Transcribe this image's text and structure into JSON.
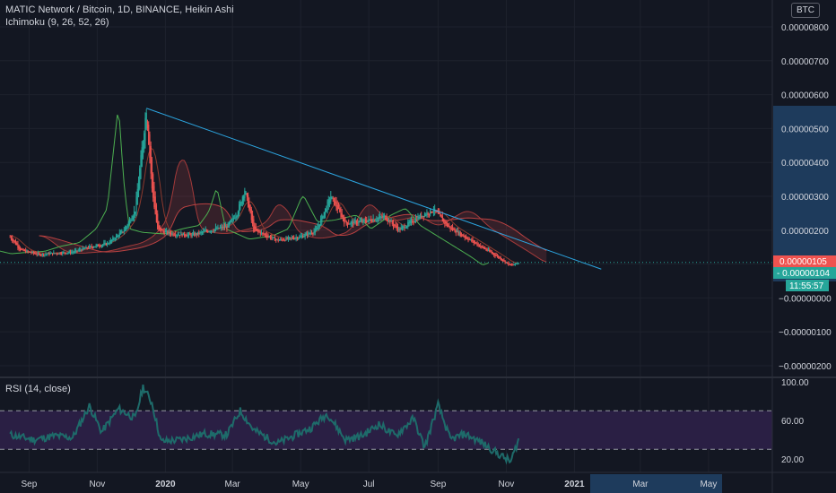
{
  "header": {
    "title": "MATIC Network / Bitcoin, 1D, BINANCE, Heikin Ashi",
    "indicator": "Ichimoku (9, 26, 52, 26)",
    "currency_button": "BTC"
  },
  "price_axis": {
    "ticks": [
      "0.00000800",
      "0.00000700",
      "0.00000600",
      "0.00000500",
      "0.00000400",
      "0.00000300",
      "0.00000200",
      "0.00000105",
      "0.00000104",
      "−0.00000000",
      "−0.00000100",
      "−0.00000200"
    ],
    "last_price": "0.00000105",
    "last_close": "0.00000104",
    "countdown": "11:55:57"
  },
  "rsi": {
    "label": "RSI (14, close)",
    "ticks": [
      "100.00",
      "60.00",
      "20.00"
    ],
    "upper_band": 70,
    "lower_band": 30
  },
  "time_axis": {
    "labels": [
      "Sep",
      "Nov",
      "2020",
      "Mar",
      "May",
      "Jul",
      "Sep",
      "Nov",
      "2021",
      "Mar",
      "May"
    ]
  },
  "colors": {
    "background": "#131722",
    "up": "#26a69a",
    "down": "#ef5350",
    "trendline": "#2ca5e0",
    "rsi_line": "#1e6b6a",
    "rsi_band_fill": "#2a1f44"
  },
  "chart_data": [
    {
      "type": "candlestick",
      "style": "Heikin Ashi",
      "symbol": "MATIC/BTC",
      "timeframe": "1D",
      "ylim": [
        -2.1e-06,
        8.8e-06
      ],
      "xlim": [
        "2019-08-15",
        "2021-05-31"
      ],
      "close_series": [
        {
          "x": "2019-08-15",
          "y": 1.8e-06
        },
        {
          "x": "2019-08-25",
          "y": 1.4e-06
        },
        {
          "x": "2019-09-10",
          "y": 1.28e-06
        },
        {
          "x": "2019-09-25",
          "y": 1.32e-06
        },
        {
          "x": "2019-10-10",
          "y": 1.35e-06
        },
        {
          "x": "2019-10-25",
          "y": 1.5e-06
        },
        {
          "x": "2019-11-10",
          "y": 1.6e-06
        },
        {
          "x": "2019-11-25",
          "y": 2e-06
        },
        {
          "x": "2019-12-05",
          "y": 2.6e-06
        },
        {
          "x": "2019-12-15",
          "y": 5.6e-06
        },
        {
          "x": "2019-12-20",
          "y": 3.2e-06
        },
        {
          "x": "2019-12-25",
          "y": 2e-06
        },
        {
          "x": "2020-01-05",
          "y": 1.9e-06
        },
        {
          "x": "2020-01-25",
          "y": 1.85e-06
        },
        {
          "x": "2020-02-10",
          "y": 2e-06
        },
        {
          "x": "2020-02-25",
          "y": 2.1e-06
        },
        {
          "x": "2020-03-05",
          "y": 2.5e-06
        },
        {
          "x": "2020-03-12",
          "y": 3.2e-06
        },
        {
          "x": "2020-03-20",
          "y": 2e-06
        },
        {
          "x": "2020-04-10",
          "y": 1.7e-06
        },
        {
          "x": "2020-05-01",
          "y": 1.8e-06
        },
        {
          "x": "2020-05-15",
          "y": 2e-06
        },
        {
          "x": "2020-05-28",
          "y": 3e-06
        },
        {
          "x": "2020-06-10",
          "y": 2.2e-06
        },
        {
          "x": "2020-06-25",
          "y": 2.25e-06
        },
        {
          "x": "2020-07-15",
          "y": 2.4e-06
        },
        {
          "x": "2020-07-28",
          "y": 2e-06
        },
        {
          "x": "2020-08-15",
          "y": 2.4e-06
        },
        {
          "x": "2020-08-28",
          "y": 2.6e-06
        },
        {
          "x": "2020-09-10",
          "y": 2.1e-06
        },
        {
          "x": "2020-09-25",
          "y": 1.8e-06
        },
        {
          "x": "2020-10-10",
          "y": 1.5e-06
        },
        {
          "x": "2020-10-25",
          "y": 1.2e-06
        },
        {
          "x": "2020-11-05",
          "y": 9.5e-07
        },
        {
          "x": "2020-11-12",
          "y": 1.04e-06
        }
      ],
      "trendline": [
        {
          "x": "2019-12-15",
          "y": 5.6e-06
        },
        {
          "x": "2021-01-25",
          "y": 8.5e-07
        }
      ],
      "last_price": 1.05e-06,
      "last_close": 1.04e-06
    },
    {
      "type": "line",
      "name": "RSI (14, close)",
      "ylim": [
        10,
        100
      ],
      "bands": [
        70,
        30
      ],
      "series": [
        {
          "x": "2019-08-15",
          "y": 45
        },
        {
          "x": "2019-09-05",
          "y": 40
        },
        {
          "x": "2019-09-25",
          "y": 44
        },
        {
          "x": "2019-10-10",
          "y": 42
        },
        {
          "x": "2019-10-25",
          "y": 75
        },
        {
          "x": "2019-11-05",
          "y": 48
        },
        {
          "x": "2019-11-20",
          "y": 72
        },
        {
          "x": "2019-12-05",
          "y": 62
        },
        {
          "x": "2019-12-12",
          "y": 95
        },
        {
          "x": "2019-12-20",
          "y": 78
        },
        {
          "x": "2019-12-28",
          "y": 38
        },
        {
          "x": "2020-01-15",
          "y": 40
        },
        {
          "x": "2020-02-05",
          "y": 46
        },
        {
          "x": "2020-02-25",
          "y": 45
        },
        {
          "x": "2020-03-08",
          "y": 70
        },
        {
          "x": "2020-03-20",
          "y": 50
        },
        {
          "x": "2020-04-10",
          "y": 36
        },
        {
          "x": "2020-04-25",
          "y": 44
        },
        {
          "x": "2020-05-10",
          "y": 52
        },
        {
          "x": "2020-05-25",
          "y": 67
        },
        {
          "x": "2020-06-10",
          "y": 40
        },
        {
          "x": "2020-06-25",
          "y": 44
        },
        {
          "x": "2020-07-10",
          "y": 56
        },
        {
          "x": "2020-07-25",
          "y": 44
        },
        {
          "x": "2020-08-10",
          "y": 62
        },
        {
          "x": "2020-08-20",
          "y": 32
        },
        {
          "x": "2020-09-01",
          "y": 76
        },
        {
          "x": "2020-09-12",
          "y": 40
        },
        {
          "x": "2020-09-25",
          "y": 46
        },
        {
          "x": "2020-10-10",
          "y": 37
        },
        {
          "x": "2020-10-25",
          "y": 25
        },
        {
          "x": "2020-11-05",
          "y": 17
        },
        {
          "x": "2020-11-12",
          "y": 40
        }
      ]
    }
  ]
}
